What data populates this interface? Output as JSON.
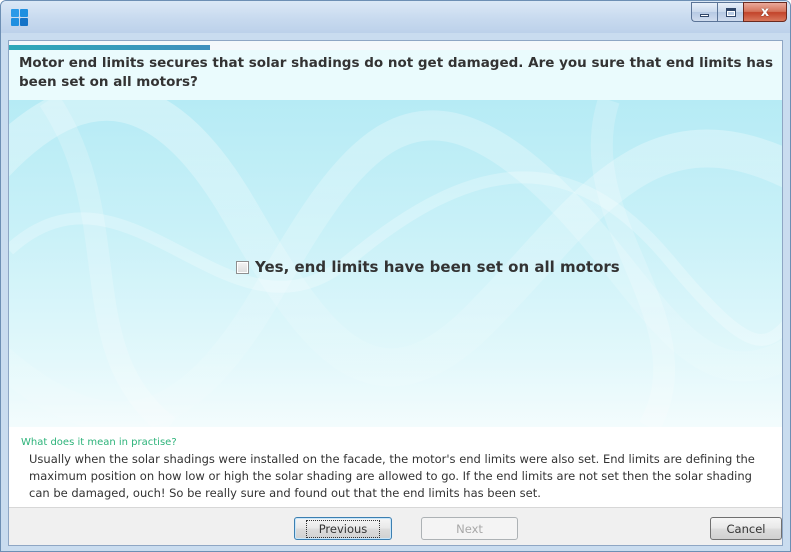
{
  "window": {
    "title": "",
    "icon": "app-grid-icon",
    "controls": {
      "minimize_icon": "minimize-icon",
      "maximize_icon": "maximize-icon",
      "close_icon": "close-icon",
      "close_glyph": "x"
    }
  },
  "wizard": {
    "progress_fraction": 0.26,
    "question": "Motor end limits secures that solar shadings do not get damaged. Are you sure that end limits has been set on all motors?",
    "confirm": {
      "checked": false,
      "label": "Yes, end limits have been set on all motors"
    },
    "help": {
      "title": "What does it mean in practise?",
      "text": "Usually when the solar shadings were installed on the facade, the motor's end limits were also set. End limits are defining the maximum position on how low or high the solar shading are allowed to go. If the end limits are not set then the solar shading can be damaged, ouch! So be really sure and found out that the end limits has been set."
    },
    "buttons": {
      "previous": "Previous",
      "next": "Next",
      "cancel": "Cancel"
    }
  },
  "colors": {
    "accent": "#2ea8b8",
    "help_title": "#2db37a",
    "background_gradient_top": "#b6ebf5"
  }
}
